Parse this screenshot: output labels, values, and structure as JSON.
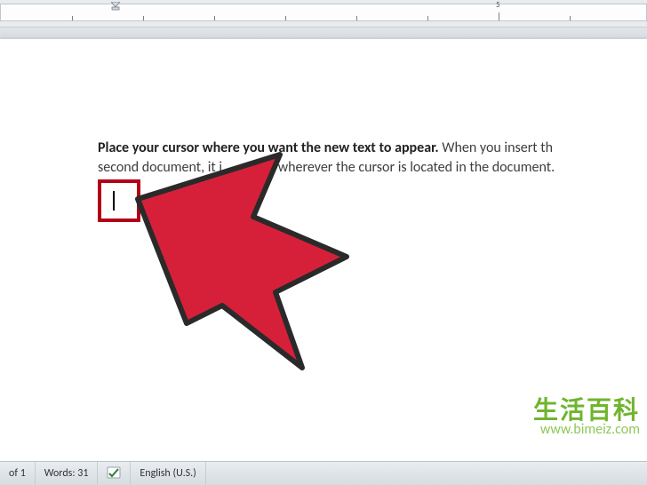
{
  "ruler": {
    "big_tick_label": "5"
  },
  "document": {
    "bold_text": "Place your cursor where you want the new text to appear.",
    "line1_rest": " When you insert th",
    "line2_a": "second document, it i",
    "line2_b": "d wherever the cursor is located in the document."
  },
  "status_bar": {
    "page": "of 1",
    "words_label": "Words:",
    "words_count": "31",
    "language": "English (U.S.)"
  },
  "watermark": {
    "cn": "生活百科",
    "url": "www.bimeiz.com"
  }
}
